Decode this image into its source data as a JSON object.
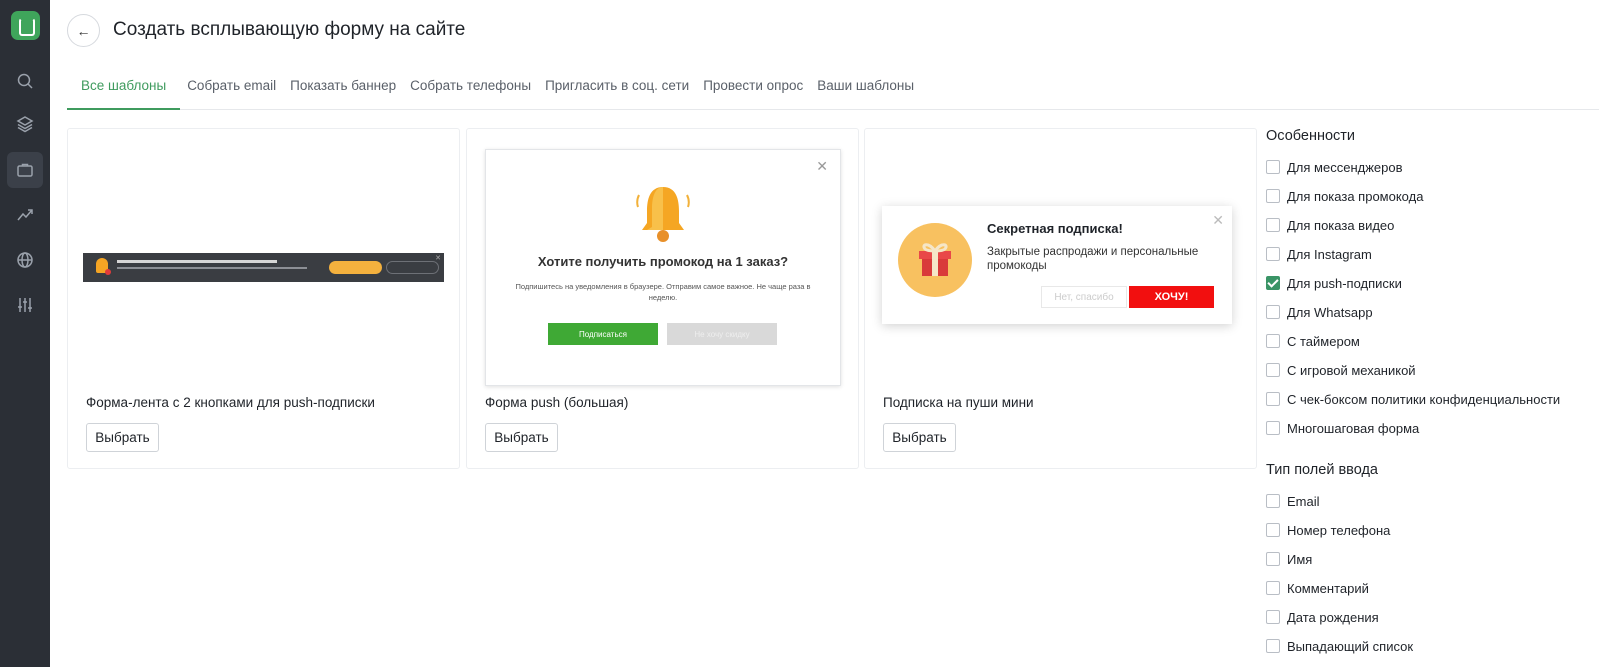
{
  "header": {
    "title": "Создать всплывающую форму на сайте"
  },
  "sidebar": {
    "icons": [
      "logo-icon",
      "search-icon",
      "layers-icon",
      "briefcase-icon",
      "trend-icon",
      "globe-icon",
      "sliders-icon"
    ],
    "active": "briefcase-icon"
  },
  "tabs": [
    {
      "label": "Все шаблоны",
      "active": true
    },
    {
      "label": "Собрать email",
      "active": false
    },
    {
      "label": "Показать баннер",
      "active": false
    },
    {
      "label": "Собрать телефоны",
      "active": false
    },
    {
      "label": "Пригласить в соц. сети",
      "active": false
    },
    {
      "label": "Провести опрос",
      "active": false
    },
    {
      "label": "Ваши шаблоны",
      "active": false
    }
  ],
  "cards": [
    {
      "caption": "Форма-лента с 2 кнопками для push-подписки",
      "button": "Выбрать"
    },
    {
      "caption": "Форма push (большая)",
      "button": "Выбрать",
      "preview": {
        "title": "Хотите получить промокод на 1 заказ?",
        "description": "Подпишитесь на уведомления в браузере. Отправим самое важное. Не чаще раза в неделю.",
        "subscribe": "Подписаться",
        "decline": "Не хочу скидку"
      }
    },
    {
      "caption": "Подписка на пуши мини",
      "button": "Выбрать",
      "preview": {
        "title": "Секретная подписка!",
        "description": "Закрытые распродажи и персональные промокоды",
        "decline": "Нет, спасибо",
        "accept": "ХОЧУ!"
      }
    }
  ],
  "filters": {
    "features_heading": "Особенности",
    "features": [
      {
        "label": "Для мессенджеров",
        "checked": false
      },
      {
        "label": "Для показа промокода",
        "checked": false
      },
      {
        "label": "Для показа видео",
        "checked": false
      },
      {
        "label": "Для Instagram",
        "checked": false
      },
      {
        "label": "Для push-подписки",
        "checked": true
      },
      {
        "label": "Для Whatsapp",
        "checked": false
      },
      {
        "label": "С таймером",
        "checked": false
      },
      {
        "label": "С игровой механикой",
        "checked": false
      },
      {
        "label": "С чек-боксом политики конфиденциальности",
        "checked": false
      },
      {
        "label": "Многошаговая форма",
        "checked": false
      }
    ],
    "inputs_heading": "Тип полей ввода",
    "inputs": [
      {
        "label": "Email",
        "checked": false
      },
      {
        "label": "Номер телефона",
        "checked": false
      },
      {
        "label": "Имя",
        "checked": false
      },
      {
        "label": "Комментарий",
        "checked": false
      },
      {
        "label": "Дата рождения",
        "checked": false
      },
      {
        "label": "Выпадающий список",
        "checked": false
      }
    ]
  },
  "colors": {
    "accent": "#3f9b5e",
    "sidebar": "#2b2f36",
    "checkbox_checked": "#3a9466"
  }
}
